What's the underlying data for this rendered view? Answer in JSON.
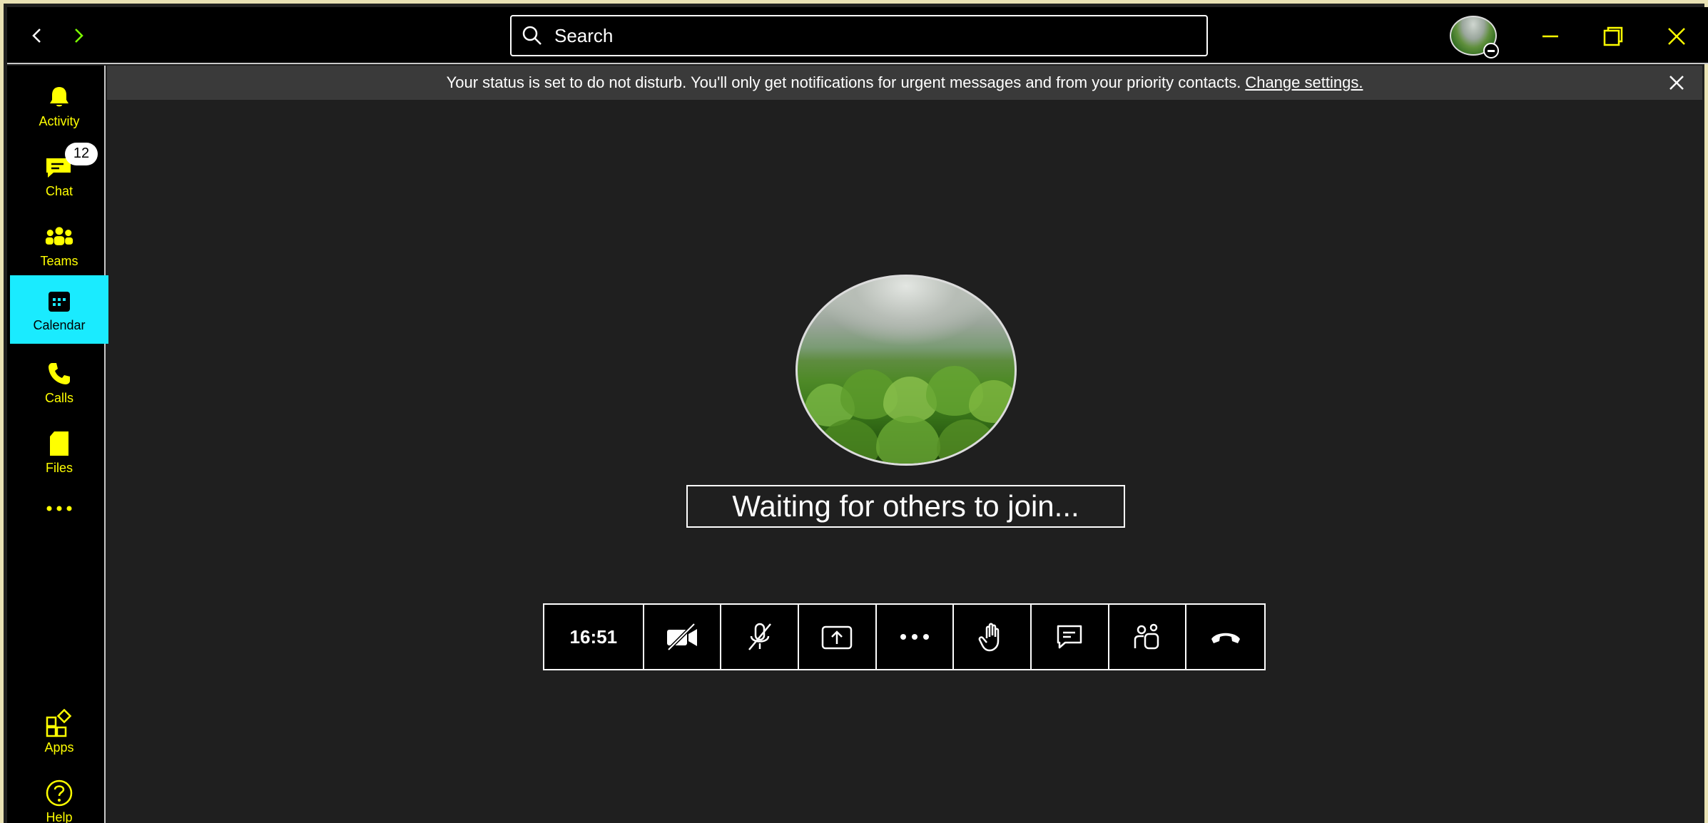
{
  "window": {
    "search_placeholder": "Search"
  },
  "rail": {
    "items": [
      {
        "label": "Activity",
        "icon": "bell-icon"
      },
      {
        "label": "Chat",
        "icon": "chat-icon",
        "badge": "12"
      },
      {
        "label": "Teams",
        "icon": "teams-icon"
      },
      {
        "label": "Calendar",
        "icon": "calendar-icon",
        "active": true
      },
      {
        "label": "Calls",
        "icon": "phone-icon"
      },
      {
        "label": "Files",
        "icon": "file-icon"
      },
      {
        "label": "",
        "icon": "more-icon"
      },
      {
        "label": "Apps",
        "icon": "apps-icon"
      },
      {
        "label": "Help",
        "icon": "help-icon"
      }
    ]
  },
  "banner": {
    "message": "Your status is set to do not disturb. You'll only get notifications for urgent messages and from your priority contacts.",
    "link": "Change settings."
  },
  "meeting": {
    "status": "Waiting for others to join...",
    "timer": "16:51"
  },
  "controls": [
    {
      "name": "camera-off-button",
      "icon": "camera-off-icon"
    },
    {
      "name": "mic-off-button",
      "icon": "mic-off-icon"
    },
    {
      "name": "share-button",
      "icon": "share-icon"
    },
    {
      "name": "more-actions-button",
      "icon": "more-icon"
    },
    {
      "name": "raise-hand-button",
      "icon": "hand-icon"
    },
    {
      "name": "chat-button",
      "icon": "chat-icon"
    },
    {
      "name": "participants-button",
      "icon": "participants-icon"
    },
    {
      "name": "hang-up-button",
      "icon": "hang-up-icon"
    }
  ],
  "colors": {
    "accent": "#ffff00",
    "active_tab": "#1aebff",
    "background": "#1f1f1f",
    "border": "#ffffff"
  }
}
